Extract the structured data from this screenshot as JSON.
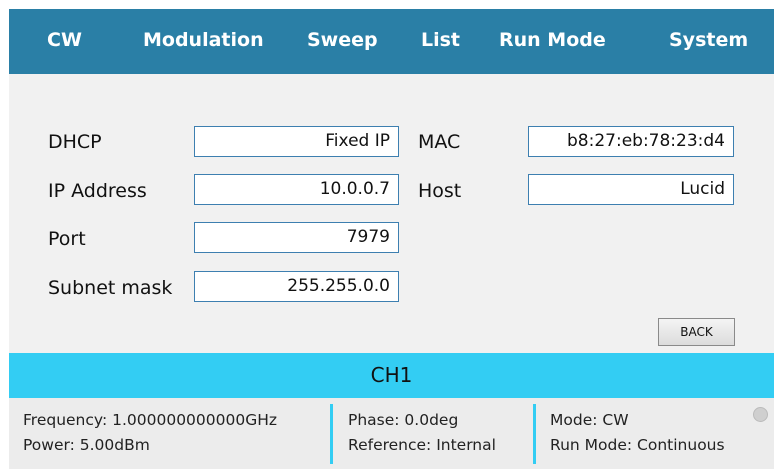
{
  "nav": {
    "cw": "CW",
    "modulation": "Modulation",
    "sweep": "Sweep",
    "list": "List",
    "run_mode": "Run Mode",
    "system": "System"
  },
  "network": {
    "dhcp_label": "DHCP",
    "dhcp_value": "Fixed IP",
    "ip_label": "IP Address",
    "ip_value": "10.0.0.7",
    "port_label": "Port",
    "port_value": "7979",
    "subnet_label": "Subnet mask",
    "subnet_value": "255.255.0.0",
    "mac_label": "MAC",
    "mac_value": "b8:27:eb:78:23:d4",
    "host_label": "Host",
    "host_value": "Lucid"
  },
  "back_button": "BACK",
  "channel": "CH1",
  "status": {
    "frequency": "Frequency: 1.000000000000GHz",
    "power": "Power: 5.00dBm",
    "phase": "Phase: 0.0deg",
    "reference": "Reference: Internal",
    "mode": "Mode: CW",
    "run_mode": "Run Mode: Continuous"
  },
  "colors": {
    "nav_bg": "#2a7fa6",
    "channel_bar": "#33cdf3",
    "field_border": "#3d7fb0"
  }
}
